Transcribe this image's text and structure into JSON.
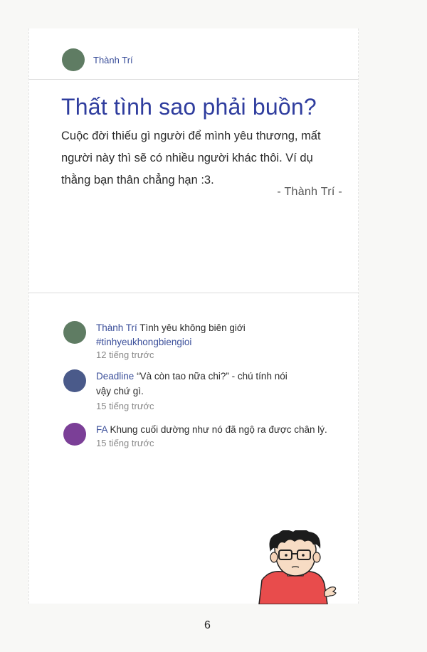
{
  "post": {
    "author": "Thành Trí",
    "title": "Thất tình sao phải buồn?",
    "body": "Cuộc đời thiếu gì người để mình yêu thương, mất người này thì sẽ có nhiều người khác thôi. Ví dụ thằng bạn thân chẳng hạn :3.",
    "signature": "- Thành Trí -"
  },
  "comments": [
    {
      "author": "Thành Trí",
      "text": "Tình yêu không biên giới",
      "hashtag": "#tinhyeukhongbiengioi",
      "time": "12 tiếng trước",
      "avatar_color": "#5f7c63"
    },
    {
      "author": "Deadline",
      "text": "“Và còn tao nữa chi?” - chú tính nói vậy chứ gì.",
      "time": "15 tiếng trước",
      "avatar_color": "#4a5a8a"
    },
    {
      "author": "FA",
      "text": "Khung cuối dường như nó đã ngộ ra được chân lý.",
      "time": "15 tiếng trước",
      "avatar_color": "#7b3f97"
    }
  ],
  "page_number": "6",
  "colors": {
    "title": "#2f3d9e",
    "author_name": "#3b4f9a",
    "post_avatar": "#5f7c63"
  }
}
